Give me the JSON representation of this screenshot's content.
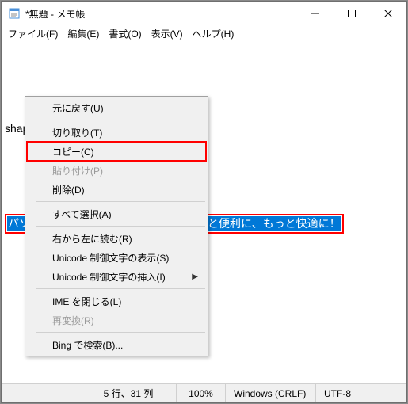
{
  "title": "*無題 - メモ帳",
  "menus": {
    "file": "ファイル(F)",
    "edit": "編集(E)",
    "format": "書式(O)",
    "view": "表示(V)",
    "help": "ヘルプ(H)"
  },
  "text": {
    "line1": "shaping tomorrow with you",
    "line2_selected": "パソコンライフを、もっと楽しく、もっと便利に、もっと快適に！"
  },
  "context": {
    "undo": "元に戻す(U)",
    "cut": "切り取り(T)",
    "copy": "コピー(C)",
    "paste": "貼り付け(P)",
    "delete": "削除(D)",
    "select_all": "すべて選択(A)",
    "rtl": "右から左に読む(R)",
    "ucd_show": "Unicode 制御文字の表示(S)",
    "ucd_insert": "Unicode 制御文字の挿入(I)",
    "ime_close": "IME を閉じる(L)",
    "reconvert": "再変換(R)",
    "bing": "Bing で検索(B)..."
  },
  "status": {
    "pos": "5 行、31 列",
    "zoom": "100%",
    "eol": "Windows (CRLF)",
    "enc": "UTF-8"
  }
}
